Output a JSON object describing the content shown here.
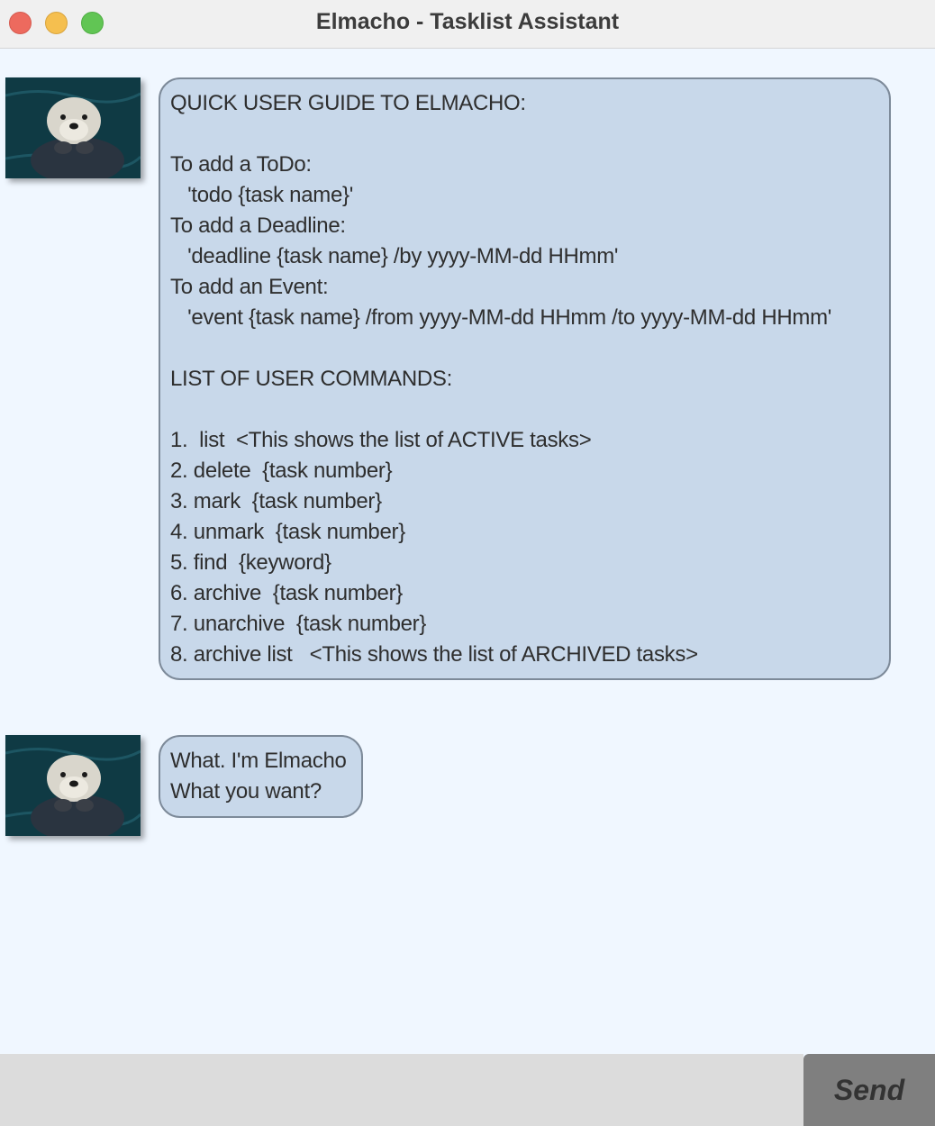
{
  "window": {
    "title": "Elmacho - Tasklist Assistant"
  },
  "messages": [
    {
      "sender": "Elmacho",
      "lines": [
        "QUICK USER GUIDE TO ELMACHO:",
        "",
        "To add a ToDo:",
        "   'todo {task name}'",
        "To add a Deadline:",
        "   'deadline {task name} /by yyyy-MM-dd HHmm'",
        "To add an Event:",
        "   'event {task name} /from yyyy-MM-dd HHmm /to yyyy-MM-dd HHmm'",
        "",
        "LIST OF USER COMMANDS:",
        "",
        "1.  list  <This shows the list of ACTIVE tasks>",
        "2. delete  {task number}",
        "3. mark  {task number}",
        "4. unmark  {task number}",
        "5. find  {keyword}",
        "6. archive  {task number}",
        "7. unarchive  {task number}",
        "8. archive list   <This shows the list of ARCHIVED tasks>"
      ]
    },
    {
      "sender": "Elmacho",
      "lines": [
        "What. I'm Elmacho",
        "What you want?"
      ]
    }
  ],
  "input": {
    "value": "",
    "placeholder": ""
  },
  "send_button": {
    "label": "Send"
  },
  "colors": {
    "background": "#f0f7ff",
    "bubble_fill": "#c8d8ea",
    "bubble_border": "#7d8a99",
    "input_bar": "#dcdcdc",
    "send_button": "#7f7f7f"
  }
}
